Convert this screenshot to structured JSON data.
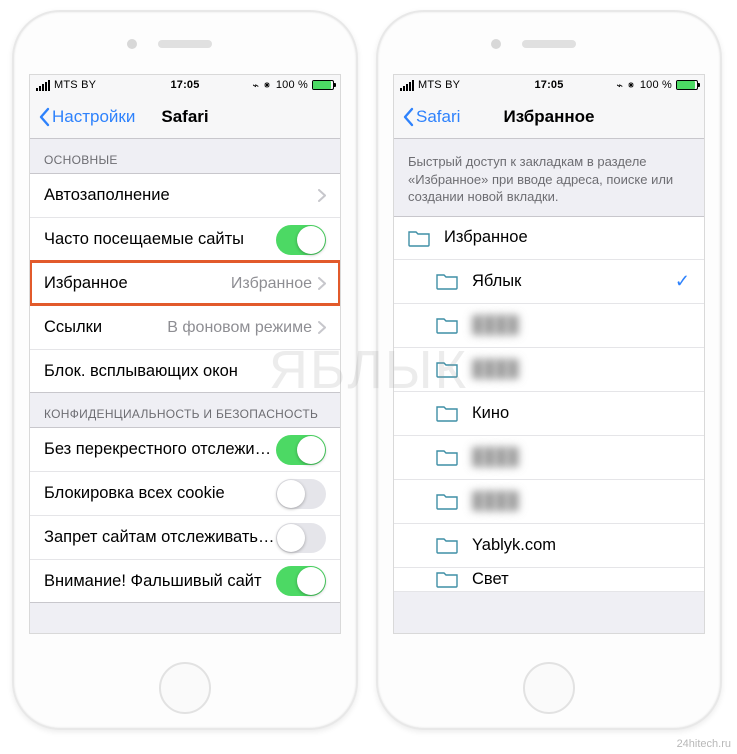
{
  "status": {
    "carrier": "MTS BY",
    "time": "17:05",
    "battery_pct": "100 %"
  },
  "left": {
    "nav": {
      "back": "Настройки",
      "title": "Safari"
    },
    "section1_header": "ОСНОВНЫЕ",
    "rows": {
      "autofill": "Автозаполнение",
      "frequent": "Часто посещаемые сайты",
      "favorites": {
        "label": "Избранное",
        "value": "Избранное"
      },
      "links": {
        "label": "Ссылки",
        "value": "В фоновом режиме"
      },
      "popups": "Блок. всплывающих окон"
    },
    "section2_header": "КОНФИДЕНЦИАЛЬНОСТЬ И БЕЗОПАСНОСТЬ",
    "rows2": {
      "crosstrack": "Без перекрестного отслежива…",
      "cookies": "Блокировка всех cookie",
      "tracking": "Запрет сайтам отслеживать м…",
      "fraud": "Внимание! Фальшивый сайт"
    }
  },
  "right": {
    "nav": {
      "back": "Safari",
      "title": "Избранное"
    },
    "note": "Быстрый доступ к закладкам в разделе «Избранное» при вводе адреса, поиске или создании новой вкладки.",
    "root": "Избранное",
    "folders": [
      {
        "name": "Яблык",
        "selected": true
      },
      {
        "name": "hidden1",
        "blur": true
      },
      {
        "name": "hidden2",
        "blur": true
      },
      {
        "name": "Кино"
      },
      {
        "name": "hidden3",
        "blur": true
      },
      {
        "name": "hidden4",
        "blur": true
      },
      {
        "name": "Yablyk.com"
      },
      {
        "name": "Свет",
        "partial": true
      }
    ]
  },
  "watermark": "ЯБЛЫК",
  "credit": "24hitech.ru"
}
